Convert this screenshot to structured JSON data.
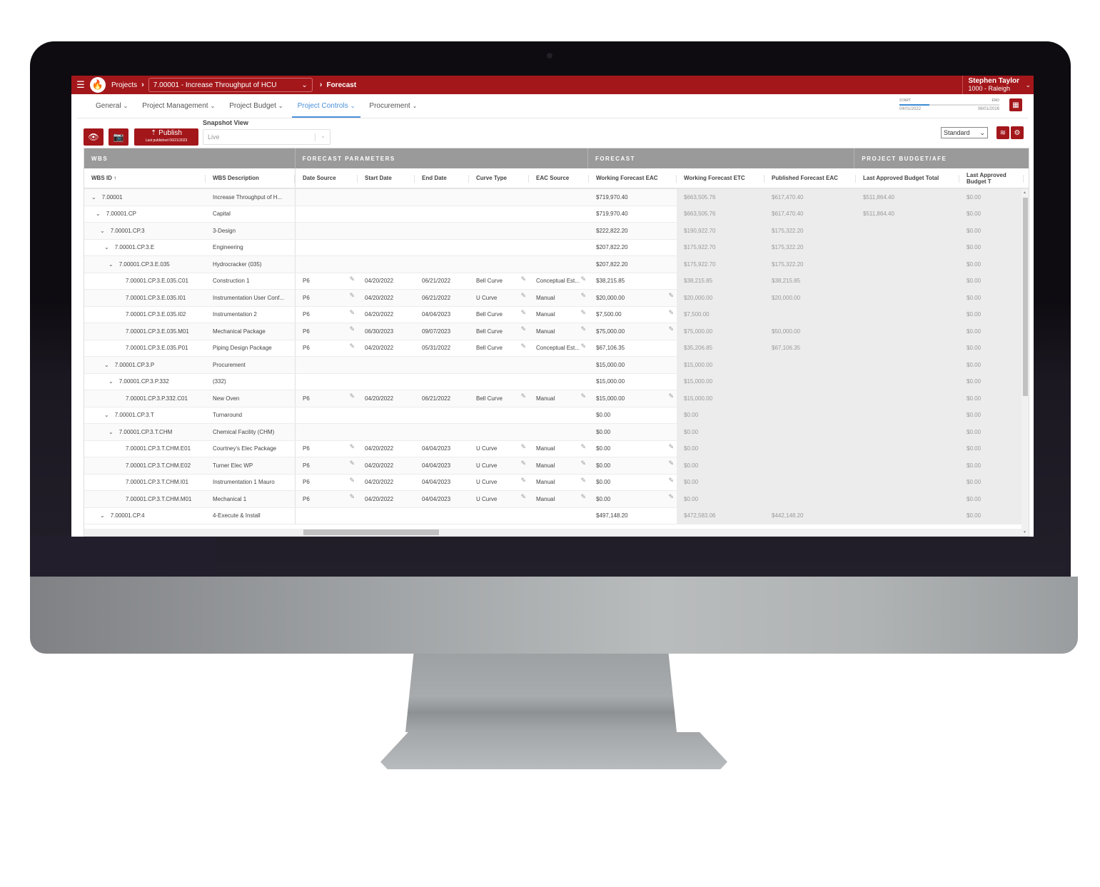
{
  "app": {
    "topbar": {
      "menu_icon": "hamburger-icon",
      "logo_icon": "flame-logo-icon",
      "breadcrumb_root": "Projects",
      "project_selected": "7.00001 - Increase Throughput of HCU",
      "breadcrumb_current": "Forecast",
      "user_name": "Stephen Taylor",
      "user_location": "1000 - Raleigh"
    },
    "nav": [
      {
        "label": "General",
        "active": false
      },
      {
        "label": "Project Management",
        "active": false
      },
      {
        "label": "Project Budget",
        "active": false
      },
      {
        "label": "Project Controls",
        "active": true
      },
      {
        "label": "Procurement",
        "active": false
      }
    ],
    "date_range": {
      "start_label": "START",
      "end_label": "END",
      "start_date": "04/01/2022",
      "end_date": "06/01/2026",
      "progress_fraction": 0.3
    },
    "toolbar": {
      "publish_label": "Publish",
      "publish_sub": "Last published 06/21/2023",
      "snapshot_label": "Snapshot View",
      "snapshot_value": "Live",
      "view_value": "Standard"
    },
    "colors": {
      "brand_red": "#a3171b",
      "active_tab": "#4a90d9",
      "group_header": "#9a9a9a"
    }
  },
  "grid": {
    "groups": [
      "WBS",
      "FORECAST PARAMETERS",
      "FORECAST",
      "PROJECT BUDGET/AFE"
    ],
    "columns": [
      "WBS ID",
      "WBS Description",
      "Date Source",
      "Start Date",
      "End Date",
      "Curve Type",
      "EAC Source",
      "Working Forecast EAC",
      "Working Forecast ETC",
      "Published Forecast EAC",
      "Last Approved Budget Total",
      "Last Approved Budget T"
    ],
    "sort_indicator": "↑",
    "rows": [
      {
        "level": 0,
        "expand": true,
        "id": "7.00001",
        "desc": "Increase Throughput of H...",
        "ds": "",
        "sd": "",
        "ed": "",
        "ct": "",
        "eac": "",
        "wfe": "$719,970.40",
        "etc": "$663,505.76",
        "pfe": "$617,470.40",
        "lab": "$511,864.40",
        "lab2": "$0.00",
        "editable": false
      },
      {
        "level": 1,
        "expand": true,
        "id": "7.00001.CP",
        "desc": "Capital",
        "ds": "",
        "sd": "",
        "ed": "",
        "ct": "",
        "eac": "",
        "wfe": "$719,970.40",
        "etc": "$663,505.76",
        "pfe": "$617,470.40",
        "lab": "$511,864.40",
        "lab2": "$0.00",
        "editable": false
      },
      {
        "level": 2,
        "expand": true,
        "id": "7.00001.CP.3",
        "desc": "3-Design",
        "ds": "",
        "sd": "",
        "ed": "",
        "ct": "",
        "eac": "",
        "wfe": "$222,822.20",
        "etc": "$190,922.70",
        "pfe": "$175,322.20",
        "lab": "",
        "lab2": "$0.00",
        "editable": false
      },
      {
        "level": 3,
        "expand": true,
        "id": "7.00001.CP.3.E",
        "desc": "Engineering",
        "ds": "",
        "sd": "",
        "ed": "",
        "ct": "",
        "eac": "",
        "wfe": "$207,822.20",
        "etc": "$175,922.70",
        "pfe": "$175,322.20",
        "lab": "",
        "lab2": "$0.00",
        "editable": false
      },
      {
        "level": 4,
        "expand": true,
        "id": "7.00001.CP.3.E.035",
        "desc": "Hydrocracker (035)",
        "ds": "",
        "sd": "",
        "ed": "",
        "ct": "",
        "eac": "",
        "wfe": "$207,822.20",
        "etc": "$175,922.70",
        "pfe": "$175,322.20",
        "lab": "",
        "lab2": "$0.00",
        "editable": false
      },
      {
        "level": 5,
        "expand": false,
        "id": "7.00001.CP.3.E.035.C01",
        "desc": "Construction 1",
        "ds": "P6",
        "sd": "04/20/2022",
        "ed": "06/21/2022",
        "ct": "Bell Curve",
        "eac": "Conceptual Est...",
        "wfe": "$38,215.85",
        "etc": "$38,215.85",
        "pfe": "$38,215.85",
        "lab": "",
        "lab2": "$0.00",
        "editable": true,
        "wfe_edit": false
      },
      {
        "level": 5,
        "expand": false,
        "id": "7.00001.CP.3.E.035.I01",
        "desc": "Instrumentation User Conf...",
        "ds": "P6",
        "sd": "04/20/2022",
        "ed": "06/21/2022",
        "ct": "U Curve",
        "eac": "Manual",
        "wfe": "$20,000.00",
        "etc": "$20,000.00",
        "pfe": "$20,000.00",
        "lab": "",
        "lab2": "$0.00",
        "editable": true,
        "wfe_edit": true
      },
      {
        "level": 5,
        "expand": false,
        "id": "7.00001.CP.3.E.035.I02",
        "desc": "Instrumentation 2",
        "ds": "P6",
        "sd": "04/20/2022",
        "ed": "04/04/2023",
        "ct": "Bell Curve",
        "eac": "Manual",
        "wfe": "$7,500.00",
        "etc": "$7,500.00",
        "pfe": "",
        "lab": "",
        "lab2": "$0.00",
        "editable": true,
        "wfe_edit": true
      },
      {
        "level": 5,
        "expand": false,
        "id": "7.00001.CP.3.E.035.M01",
        "desc": "Mechanical Package",
        "ds": "P6",
        "sd": "06/30/2023",
        "ed": "09/07/2023",
        "ct": "Bell Curve",
        "eac": "Manual",
        "wfe": "$75,000.00",
        "etc": "$75,000.00",
        "pfe": "$50,000.00",
        "lab": "",
        "lab2": "$0.00",
        "editable": true,
        "wfe_edit": true
      },
      {
        "level": 5,
        "expand": false,
        "id": "7.00001.CP.3.E.035.P01",
        "desc": "Piping Design Package",
        "ds": "P6",
        "sd": "04/20/2022",
        "ed": "05/31/2022",
        "ct": "Bell Curve",
        "eac": "Conceptual Est...",
        "wfe": "$67,106.35",
        "etc": "$35,206.85",
        "pfe": "$67,106.35",
        "lab": "",
        "lab2": "$0.00",
        "editable": true,
        "wfe_edit": false
      },
      {
        "level": 3,
        "expand": true,
        "id": "7.00001.CP.3.P",
        "desc": "Procurement",
        "ds": "",
        "sd": "",
        "ed": "",
        "ct": "",
        "eac": "",
        "wfe": "$15,000.00",
        "etc": "$15,000.00",
        "pfe": "",
        "lab": "",
        "lab2": "$0.00",
        "editable": false
      },
      {
        "level": 4,
        "expand": true,
        "id": "7.00001.CP.3.P.332",
        "desc": "(332)",
        "ds": "",
        "sd": "",
        "ed": "",
        "ct": "",
        "eac": "",
        "wfe": "$15,000.00",
        "etc": "$15,000.00",
        "pfe": "",
        "lab": "",
        "lab2": "$0.00",
        "editable": false
      },
      {
        "level": 5,
        "expand": false,
        "id": "7.00001.CP.3.P.332.C01",
        "desc": "New Oven",
        "ds": "P6",
        "sd": "04/20/2022",
        "ed": "06/21/2022",
        "ct": "Bell Curve",
        "eac": "Manual",
        "wfe": "$15,000.00",
        "etc": "$15,000.00",
        "pfe": "",
        "lab": "",
        "lab2": "$0.00",
        "editable": true,
        "wfe_edit": true
      },
      {
        "level": 3,
        "expand": true,
        "id": "7.00001.CP.3.T",
        "desc": "Turnaround",
        "ds": "",
        "sd": "",
        "ed": "",
        "ct": "",
        "eac": "",
        "wfe": "$0.00",
        "etc": "$0.00",
        "pfe": "",
        "lab": "",
        "lab2": "$0.00",
        "editable": false
      },
      {
        "level": 4,
        "expand": true,
        "id": "7.00001.CP.3.T.CHM",
        "desc": "Chemical Facility (CHM)",
        "ds": "",
        "sd": "",
        "ed": "",
        "ct": "",
        "eac": "",
        "wfe": "$0.00",
        "etc": "$0.00",
        "pfe": "",
        "lab": "",
        "lab2": "$0.00",
        "editable": false
      },
      {
        "level": 5,
        "expand": false,
        "id": "7.00001.CP.3.T.CHM.E01",
        "desc": "Courtney's Elec Package",
        "ds": "P6",
        "sd": "04/20/2022",
        "ed": "04/04/2023",
        "ct": "U Curve",
        "eac": "Manual",
        "wfe": "$0.00",
        "etc": "$0.00",
        "pfe": "",
        "lab": "",
        "lab2": "$0.00",
        "editable": true,
        "wfe_edit": true
      },
      {
        "level": 5,
        "expand": false,
        "id": "7.00001.CP.3.T.CHM.E02",
        "desc": "Turner Elec WP",
        "ds": "P6",
        "sd": "04/20/2022",
        "ed": "04/04/2023",
        "ct": "U Curve",
        "eac": "Manual",
        "wfe": "$0.00",
        "etc": "$0.00",
        "pfe": "",
        "lab": "",
        "lab2": "$0.00",
        "editable": true,
        "wfe_edit": true
      },
      {
        "level": 5,
        "expand": false,
        "id": "7.00001.CP.3.T.CHM.I01",
        "desc": "Instrumentation 1 Mauro",
        "ds": "P6",
        "sd": "04/20/2022",
        "ed": "04/04/2023",
        "ct": "U Curve",
        "eac": "Manual",
        "wfe": "$0.00",
        "etc": "$0.00",
        "pfe": "",
        "lab": "",
        "lab2": "$0.00",
        "editable": true,
        "wfe_edit": true
      },
      {
        "level": 5,
        "expand": false,
        "id": "7.00001.CP.3.T.CHM.M01",
        "desc": "Mechanical 1",
        "ds": "P6",
        "sd": "04/20/2022",
        "ed": "04/04/2023",
        "ct": "U Curve",
        "eac": "Manual",
        "wfe": "$0.00",
        "etc": "$0.00",
        "pfe": "",
        "lab": "",
        "lab2": "$0.00",
        "editable": true,
        "wfe_edit": true
      },
      {
        "level": 2,
        "expand": true,
        "id": "7.00001.CP.4",
        "desc": "4-Execute & Install",
        "ds": "",
        "sd": "",
        "ed": "",
        "ct": "",
        "eac": "",
        "wfe": "$497,148.20",
        "etc": "$472,583.06",
        "pfe": "$442,148.20",
        "lab": "",
        "lab2": "$0.00",
        "editable": false
      }
    ]
  }
}
